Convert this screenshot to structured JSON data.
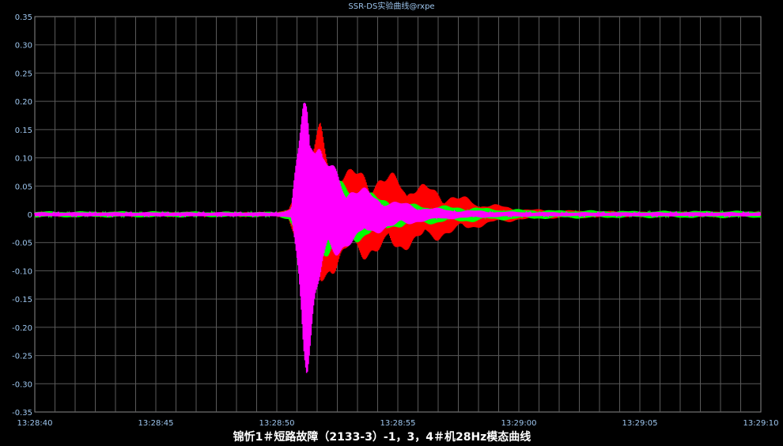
{
  "chart_data": {
    "type": "line",
    "title": "SSR-DS实验曲线@rxpe",
    "xlabel": "锦忻1＃短路故障（2133-3）-1，3，4＃机28Hz模态曲线",
    "ylabel": "",
    "grid": true,
    "ylim": [
      -0.35,
      0.35
    ],
    "y_ticks": [
      "0.35",
      "0.30",
      "0.25",
      "0.20",
      "0.15",
      "0.10",
      "0.05",
      "0",
      "-0.05",
      "-0.10",
      "-0.15",
      "-0.20",
      "-0.25",
      "-0.30",
      "-0.35"
    ],
    "y_tick_values": [
      0.35,
      0.3,
      0.25,
      0.2,
      0.15,
      0.1,
      0.05,
      0,
      -0.05,
      -0.1,
      -0.15,
      -0.2,
      -0.25,
      -0.3,
      -0.35
    ],
    "x_ticks": [
      "13:28:40",
      "13:28:45",
      "13:28:50",
      "13:28:55",
      "13:29:00",
      "13:29:05",
      "13:29:10"
    ],
    "xlim_seconds": [
      0,
      30
    ],
    "series": [
      {
        "color": "#ff0000",
        "envelope": {
          "t": [
            0,
            5,
            10,
            10.5,
            11,
            11.4,
            11.8,
            12.2,
            13,
            14,
            15,
            16,
            17,
            18,
            19,
            20,
            21,
            22,
            23,
            24,
            25,
            26,
            27,
            28,
            29,
            30
          ],
          "amp": [
            0.004,
            0.004,
            0.004,
            0.01,
            0.08,
            0.14,
            0.17,
            0.12,
            0.09,
            0.085,
            0.075,
            0.06,
            0.045,
            0.03,
            0.02,
            0.012,
            0.009,
            0.008,
            0.007,
            0.006,
            0.005,
            0.005,
            0.005,
            0.005,
            0.005,
            0.005
          ]
        }
      },
      {
        "color": "#00ff00",
        "envelope": {
          "t": [
            0,
            5,
            10,
            10.5,
            11,
            11.4,
            12,
            13,
            14,
            15,
            16,
            17,
            18,
            19,
            20,
            21,
            22,
            23,
            24,
            25,
            26,
            27,
            28,
            29,
            30
          ],
          "amp": [
            0.006,
            0.006,
            0.005,
            0.01,
            0.06,
            0.1,
            0.08,
            0.06,
            0.04,
            0.025,
            0.02,
            0.017,
            0.015,
            0.012,
            0.01,
            0.009,
            0.008,
            0.008,
            0.007,
            0.007,
            0.007,
            0.007,
            0.007,
            0.007,
            0.007
          ]
        }
      },
      {
        "color": "#ff00ff",
        "envelope": {
          "t": [
            0,
            5,
            10,
            10.6,
            10.9,
            11.1,
            11.25,
            11.4,
            11.6,
            11.9,
            12.4,
            13,
            14,
            15,
            16,
            17,
            18,
            19,
            20,
            22,
            25,
            30
          ],
          "amp": [
            0.004,
            0.004,
            0.004,
            0.01,
            0.15,
            0.27,
            0.31,
            0.28,
            0.2,
            0.12,
            0.09,
            0.065,
            0.04,
            0.025,
            0.016,
            0.01,
            0.008,
            0.006,
            0.005,
            0.004,
            0.004,
            0.004
          ]
        }
      }
    ]
  }
}
